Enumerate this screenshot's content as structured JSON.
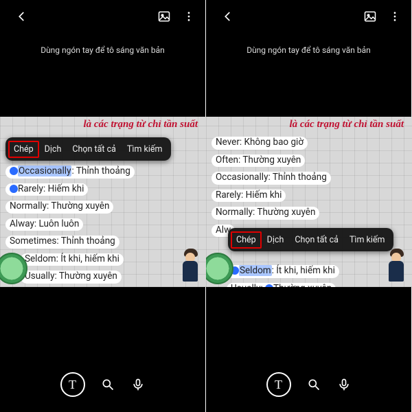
{
  "hint": "Dùng ngón tay để tô sáng văn bản",
  "cursive_title": "là các trạng từ chỉ tần suất",
  "context_menu": {
    "copy": "Chép",
    "translate": "Dịch",
    "select_all": "Chọn tất cả",
    "search": "Tìm kiếm"
  },
  "list": {
    "never": {
      "en": "Never",
      "vi": "Không bao giờ"
    },
    "often": {
      "en": "Often",
      "vi": "Thường xuyên"
    },
    "occasionally": {
      "en": "Occasionally",
      "vi": "Thỉnh thoảng"
    },
    "rarely": {
      "en": "Rarely",
      "vi": "Hiếm khi"
    },
    "normally": {
      "en": "Normally",
      "vi": "Thường xuyên"
    },
    "alway": {
      "en": "Alway",
      "vi": "Luôn luôn"
    },
    "alw_short": "Alw",
    "sometimes": {
      "en": "Sometimes",
      "vi": "Thỉnh thoảng"
    },
    "seldom": {
      "en": "Seldom",
      "vi": "Ít khi, hiếm khi"
    },
    "usually": {
      "en": "Usually",
      "vi": "Thường xuyên"
    },
    "usually_split": {
      "pre": "T",
      "rest": "hường xuyên"
    }
  },
  "text_mode_label": "T",
  "colors": {
    "highlight_red": "#e00000",
    "selection_blue": "#a9c6ff"
  }
}
